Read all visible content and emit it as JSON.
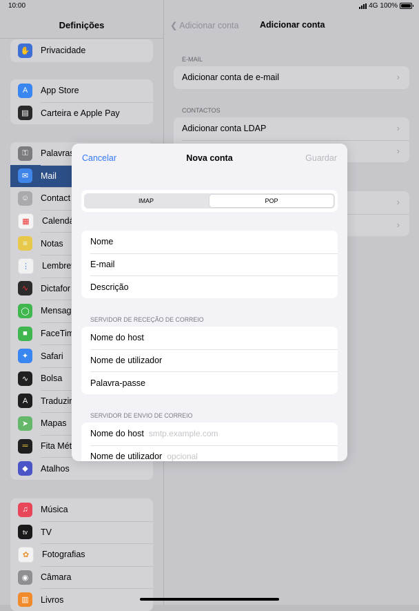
{
  "status": {
    "time": "10:00",
    "network": "4G",
    "battery": "100%"
  },
  "sidebar": {
    "title": "Definições",
    "groups": [
      {
        "items": [
          {
            "label": "Privacidade",
            "icon": "hand-icon",
            "color": "#3e6fd4",
            "glyph": "✋"
          }
        ]
      },
      {
        "items": [
          {
            "label": "App Store",
            "icon": "app-store-icon",
            "color": "#3a86f0",
            "glyph": "A"
          },
          {
            "label": "Carteira e Apple Pay",
            "icon": "wallet-icon",
            "color": "#2a2a2a",
            "glyph": "▤"
          }
        ]
      },
      {
        "items": [
          {
            "label": "Palavras",
            "icon": "key-icon",
            "color": "#7b7b80",
            "glyph": "⚿"
          },
          {
            "label": "Mail",
            "icon": "mail-icon",
            "color": "#3f86e8",
            "glyph": "✉"
          },
          {
            "label": "Contact",
            "icon": "contacts-icon",
            "color": "#a9a9ae",
            "glyph": "☺"
          },
          {
            "label": "Calendá",
            "icon": "calendar-icon",
            "color": "#f4f4f4",
            "glyph": "▦"
          },
          {
            "label": "Notas",
            "icon": "notes-icon",
            "color": "#e8c84a",
            "glyph": "≡"
          },
          {
            "label": "Lembret",
            "icon": "reminders-icon",
            "color": "#f1f1f1",
            "glyph": "⋮"
          },
          {
            "label": "Dictafor",
            "icon": "voice-memos-icon",
            "color": "#2b2b2b",
            "glyph": "∿"
          },
          {
            "label": "Mensag",
            "icon": "messages-icon",
            "color": "#3fb64e",
            "glyph": "◯"
          },
          {
            "label": "FaceTim",
            "icon": "facetime-icon",
            "color": "#3fb64e",
            "glyph": "■"
          },
          {
            "label": "Safari",
            "icon": "safari-icon",
            "color": "#3a86f0",
            "glyph": "✦"
          },
          {
            "label": "Bolsa",
            "icon": "stocks-icon",
            "color": "#202020",
            "glyph": "∿"
          },
          {
            "label": "Traduzir",
            "icon": "translate-icon",
            "color": "#1f1f1f",
            "glyph": "A"
          },
          {
            "label": "Mapas",
            "icon": "maps-icon",
            "color": "#65b86a",
            "glyph": "➤"
          },
          {
            "label": "Fita Mét",
            "icon": "measure-icon",
            "color": "#1f1f1f",
            "glyph": "═"
          },
          {
            "label": "Atalhos",
            "icon": "shortcuts-icon",
            "color": "#4b55c8",
            "glyph": "◆"
          }
        ]
      },
      {
        "items": [
          {
            "label": "Música",
            "icon": "music-icon",
            "color": "#e8475a",
            "glyph": "♫"
          },
          {
            "label": "TV",
            "icon": "tv-icon",
            "color": "#1a1a1a",
            "glyph": "tv"
          },
          {
            "label": "Fotografias",
            "icon": "photos-icon",
            "color": "#f2f2f2",
            "glyph": "✿"
          },
          {
            "label": "Câmara",
            "icon": "camera-icon",
            "color": "#8e8e93",
            "glyph": "◉"
          },
          {
            "label": "Livros",
            "icon": "books-icon",
            "color": "#f08a2a",
            "glyph": "▥"
          }
        ]
      }
    ]
  },
  "detail": {
    "back_label": "Adicionar conta",
    "title": "Adicionar conta",
    "email_section": "E-MAIL",
    "email_rows": [
      "Adicionar conta de e-mail"
    ],
    "contacts_section": "CONTACTOS",
    "contacts_rows": [
      "Adicionar conta LDAP",
      ""
    ]
  },
  "modal": {
    "cancel": "Cancelar",
    "title": "Nova conta",
    "save": "Guardar",
    "segments": [
      "IMAP",
      "POP"
    ],
    "account_fields": [
      "Nome",
      "E-mail",
      "Descrição"
    ],
    "incoming_section": "SERVIDOR DE RECEÇÃO DE CORREIO",
    "incoming_fields": [
      "Nome do host",
      "Nome de utilizador",
      "Palavra-passe"
    ],
    "outgoing_section": "SERVIDOR DE ENVIO DE CORREIO",
    "outgoing_fields": [
      {
        "label": "Nome do host",
        "placeholder": "smtp.example.com"
      },
      {
        "label": "Nome de utilizador",
        "placeholder": "opcional"
      }
    ]
  }
}
